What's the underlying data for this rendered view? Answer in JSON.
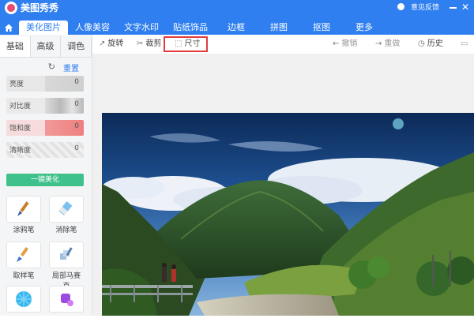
{
  "app": {
    "name": "美图秀秀",
    "feedback": "意见反馈"
  },
  "tabs": [
    "美化图片",
    "人像美容",
    "文字水印",
    "贴纸饰品",
    "边框",
    "拼图",
    "抠图",
    "更多"
  ],
  "active_tab": "美化图片",
  "left_panel": {
    "subtabs": [
      "基础",
      "高级",
      "调色"
    ],
    "active_subtab": "基础",
    "reset_label": "重置",
    "sliders": [
      {
        "label": "亮度",
        "value": "0"
      },
      {
        "label": "对比度",
        "value": "0"
      },
      {
        "label": "饱和度",
        "value": "0"
      },
      {
        "label": "清晰度",
        "value": "0"
      }
    ],
    "one_click": "一键美化",
    "tools": [
      {
        "label": "涂鸦笔",
        "icon": "brush-icon"
      },
      {
        "label": "消除笔",
        "icon": "eraser-icon"
      },
      {
        "label": "取样笔",
        "icon": "sample-brush-icon"
      },
      {
        "label": "局部马赛克",
        "icon": "mosaic-brush-icon"
      },
      {
        "label": "",
        "icon": "mosaic-ball-icon"
      },
      {
        "label": "",
        "icon": "purple-tool-icon"
      }
    ]
  },
  "toolbar": {
    "rotate": "旋转",
    "crop": "裁剪",
    "size": "尺寸",
    "undo": "撤销",
    "redo": "重做",
    "history": "历史"
  },
  "colors": {
    "brand_blue": "#2f7ff0",
    "accent_green": "#3ec18b",
    "highlight_red": "#e23b3b",
    "logo_pink": "#e94a73"
  }
}
